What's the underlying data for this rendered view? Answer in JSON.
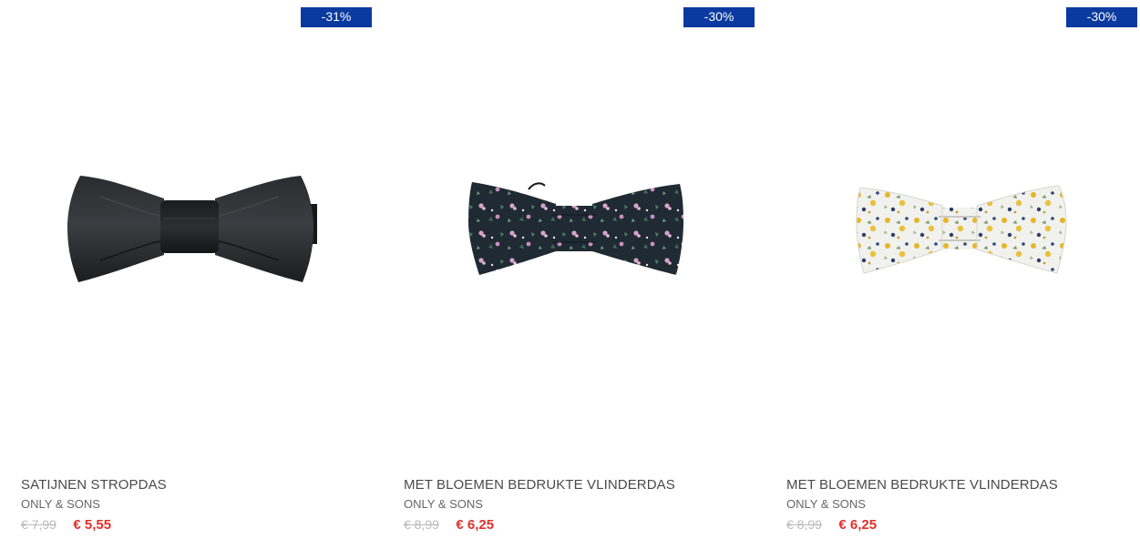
{
  "products": [
    {
      "discount": "-31%",
      "name": "SATIJNEN STROPDAS",
      "brand": "ONLY & SONS",
      "old_price": "€ 7,99",
      "new_price": "€ 5,55",
      "image": "black-satin-bow-tie"
    },
    {
      "discount": "-30%",
      "name": "MET BLOEMEN BEDRUKTE VLINDERDAS",
      "brand": "ONLY & SONS",
      "old_price": "€ 8,99",
      "new_price": "€ 6,25",
      "image": "navy-floral-bow-tie"
    },
    {
      "discount": "-30%",
      "name": "MET BLOEMEN BEDRUKTE VLINDERDAS",
      "brand": "ONLY & SONS",
      "old_price": "€ 8,99",
      "new_price": "€ 6,25",
      "image": "white-yellow-floral-bow-tie"
    }
  ],
  "colors": {
    "badge": "#0a3aa0",
    "sale_price": "#e0302b",
    "old_price": "#b9b9b9"
  }
}
